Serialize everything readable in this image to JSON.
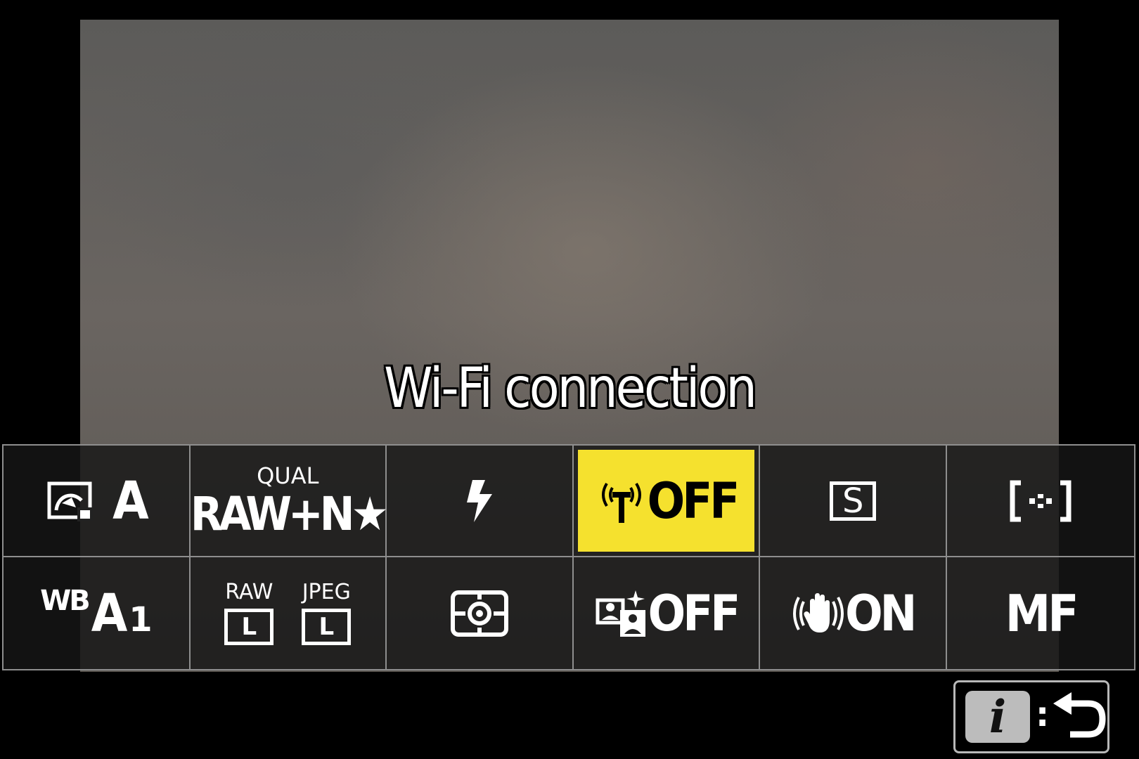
{
  "status_message": "Wi-Fi connection",
  "i_menu": {
    "row1": {
      "picture_control": {
        "icon": "picture-control-icon",
        "value": "A"
      },
      "image_quality": {
        "label": "QUAL",
        "value": "RAW+N★"
      },
      "flash_mode": {
        "icon": "flash-icon"
      },
      "wifi": {
        "icon": "wifi-antenna-icon",
        "value": "OFF",
        "selected": true
      },
      "release_mode": {
        "icon": "single-frame-icon",
        "value": "S"
      },
      "af_area_mode": {
        "icon": "af-area-bracket-icon"
      }
    },
    "row2": {
      "white_balance": {
        "label": "WB",
        "value": "A",
        "sub": "1"
      },
      "image_size": {
        "raw_label": "RAW",
        "jpeg_label": "JPEG",
        "raw_value": "L",
        "jpeg_value": "L"
      },
      "metering": {
        "icon": "matrix-metering-icon"
      },
      "active_d_lighting": {
        "icon": "active-d-lighting-icon",
        "value": "OFF"
      },
      "vibration_reduction": {
        "icon": "vr-hand-icon",
        "value": "ON"
      },
      "focus_mode": {
        "value": "MF"
      }
    }
  },
  "footer": {
    "i_label": "i",
    "colon": ":"
  },
  "colors": {
    "selected_bg": "#f5e12e",
    "grid_line": "#8e8e8e"
  }
}
